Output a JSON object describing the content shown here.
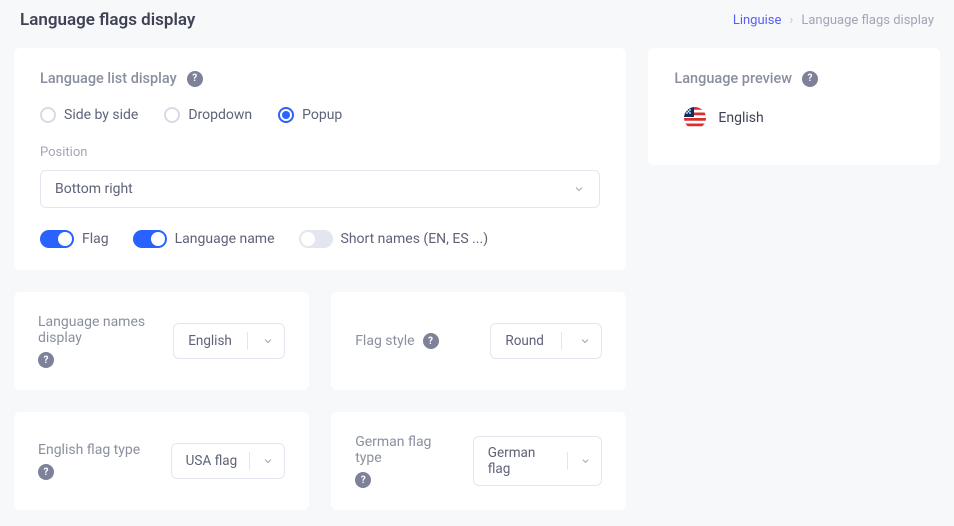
{
  "header": {
    "title": "Language flags display",
    "breadcrumb": {
      "root": "Linguise",
      "current": "Language flags display",
      "separator": "›"
    }
  },
  "list_display": {
    "title": "Language list display",
    "options": {
      "side_by_side": "Side by side",
      "dropdown": "Dropdown",
      "popup": "Popup"
    },
    "selected": "popup",
    "position_label": "Position",
    "position_value": "Bottom right",
    "toggles": {
      "flag": {
        "label": "Flag",
        "on": true
      },
      "language_name": {
        "label": "Language name",
        "on": true
      },
      "short_names": {
        "label": "Short names (EN, ES ...)",
        "on": false
      }
    }
  },
  "panels": {
    "names_display": {
      "label": "Language names display",
      "value": "English"
    },
    "flag_style": {
      "label": "Flag style",
      "value": "Round"
    },
    "english_flag": {
      "label": "English flag type",
      "value": "USA flag"
    },
    "german_flag": {
      "label": "German flag type",
      "value": "German flag"
    }
  },
  "preview": {
    "title": "Language preview",
    "language": "English"
  }
}
